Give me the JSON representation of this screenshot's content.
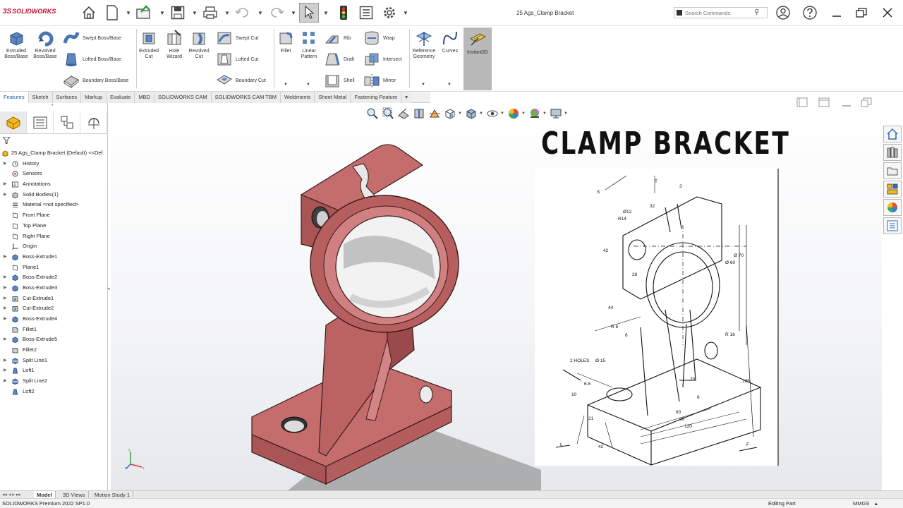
{
  "app": {
    "logo_prefix": "3S",
    "logo_text": "SOLIDWORKS",
    "doc_title": "25 Ags_Clamp Bracket"
  },
  "search": {
    "placeholder": "Search Commands"
  },
  "ribbon": {
    "extruded_boss": "Extruded Boss/Base",
    "revolved_boss": "Revolved Boss/Base",
    "swept_boss": "Swept Boss/Base",
    "lofted_boss": "Lofted Boss/Base",
    "boundary_boss": "Boundary Boss/Base",
    "extruded_cut": "Extruded Cut",
    "hole_wizard": "Hole Wizard",
    "revolved_cut": "Revolved Cut",
    "swept_cut": "Swept Cut",
    "lofted_cut": "Lofted Cut",
    "boundary_cut": "Boundary Cut",
    "fillet": "Fillet",
    "linear_pattern": "Linear Pattern",
    "rib": "Rib",
    "draft": "Draft",
    "shell": "Shell",
    "wrap": "Wrap",
    "intersect": "Intersect",
    "mirror": "Mirror",
    "reference_geometry": "Reference Geometry",
    "curves": "Curves",
    "instant3d": "Instant3D"
  },
  "tabs": [
    "Features",
    "Sketch",
    "Surfaces",
    "Markup",
    "Evaluate",
    "MBD",
    "SOLIDWORKS CAM",
    "SOLIDWORKS CAM TBM",
    "Weldments",
    "Sheet Metal",
    "Fastening Feature"
  ],
  "tree": {
    "root": "25 Ags_Clamp Bracket (Default) <<Def",
    "items": [
      {
        "label": "History",
        "icon": "history-icon",
        "expandable": true
      },
      {
        "label": "Sensors",
        "icon": "sensors-icon",
        "expandable": false
      },
      {
        "label": "Annotations",
        "icon": "annotations-icon",
        "expandable": true
      },
      {
        "label": "Solid Bodies(1)",
        "icon": "solid-bodies-icon",
        "expandable": true
      },
      {
        "label": "Material <not specified>",
        "icon": "material-icon",
        "expandable": false
      },
      {
        "label": "Front Plane",
        "icon": "plane-icon",
        "expandable": false
      },
      {
        "label": "Top Plane",
        "icon": "plane-icon",
        "expandable": false
      },
      {
        "label": "Right Plane",
        "icon": "plane-icon",
        "expandable": false
      },
      {
        "label": "Origin",
        "icon": "origin-icon",
        "expandable": false
      },
      {
        "label": "Boss-Extrude1",
        "icon": "extrude-feature-icon",
        "expandable": true
      },
      {
        "label": "Plane1",
        "icon": "plane-icon",
        "expandable": false
      },
      {
        "label": "Boss-Extrude2",
        "icon": "extrude-feature-icon",
        "expandable": true
      },
      {
        "label": "Boss-Extrude3",
        "icon": "extrude-feature-icon",
        "expandable": true
      },
      {
        "label": "Cut-Extrude1",
        "icon": "cut-feature-icon",
        "expandable": true
      },
      {
        "label": "Cut-Extrude2",
        "icon": "cut-feature-icon",
        "expandable": true
      },
      {
        "label": "Boss-Extrude4",
        "icon": "extrude-feature-icon",
        "expandable": true
      },
      {
        "label": "Fillet1",
        "icon": "fillet-feature-icon",
        "expandable": false
      },
      {
        "label": "Boss-Extrude5",
        "icon": "extrude-feature-icon",
        "expandable": true
      },
      {
        "label": "Fillet2",
        "icon": "fillet-feature-icon",
        "expandable": false
      },
      {
        "label": "Split Line1",
        "icon": "split-line-icon",
        "expandable": true
      },
      {
        "label": "Loft1",
        "icon": "loft-feature-icon",
        "expandable": true
      },
      {
        "label": "Split Line2",
        "icon": "split-line-icon",
        "expandable": true
      },
      {
        "label": "Loft2",
        "icon": "loft-feature-icon",
        "expandable": false
      }
    ]
  },
  "viewport": {
    "overlay_title": "CLAMP BRACKET"
  },
  "drawing": {
    "labels": [
      "32",
      "3",
      "Ø12",
      "R14",
      "42",
      "28",
      "Ø 60",
      "Ø 70",
      "44",
      "R 6",
      "6",
      "R 16",
      "2 HOLES",
      "Ø 15",
      "6.8",
      "20",
      "10",
      "21",
      "6",
      "60",
      "90",
      "120",
      "105",
      "42",
      "T",
      "S",
      "L",
      "F"
    ]
  },
  "bottom_tabs": [
    "Model",
    "3D Views",
    "Motion Study 1"
  ],
  "status": {
    "left": "SOLIDWORKS Premium 2022 SP1.0",
    "mode": "Editing Part",
    "units": "MMGS"
  },
  "colors": {
    "part_body": "#c77676",
    "part_shadow": "#8e4646",
    "accent_blue": "#1a5aa5",
    "brand_red": "#c8102e"
  }
}
